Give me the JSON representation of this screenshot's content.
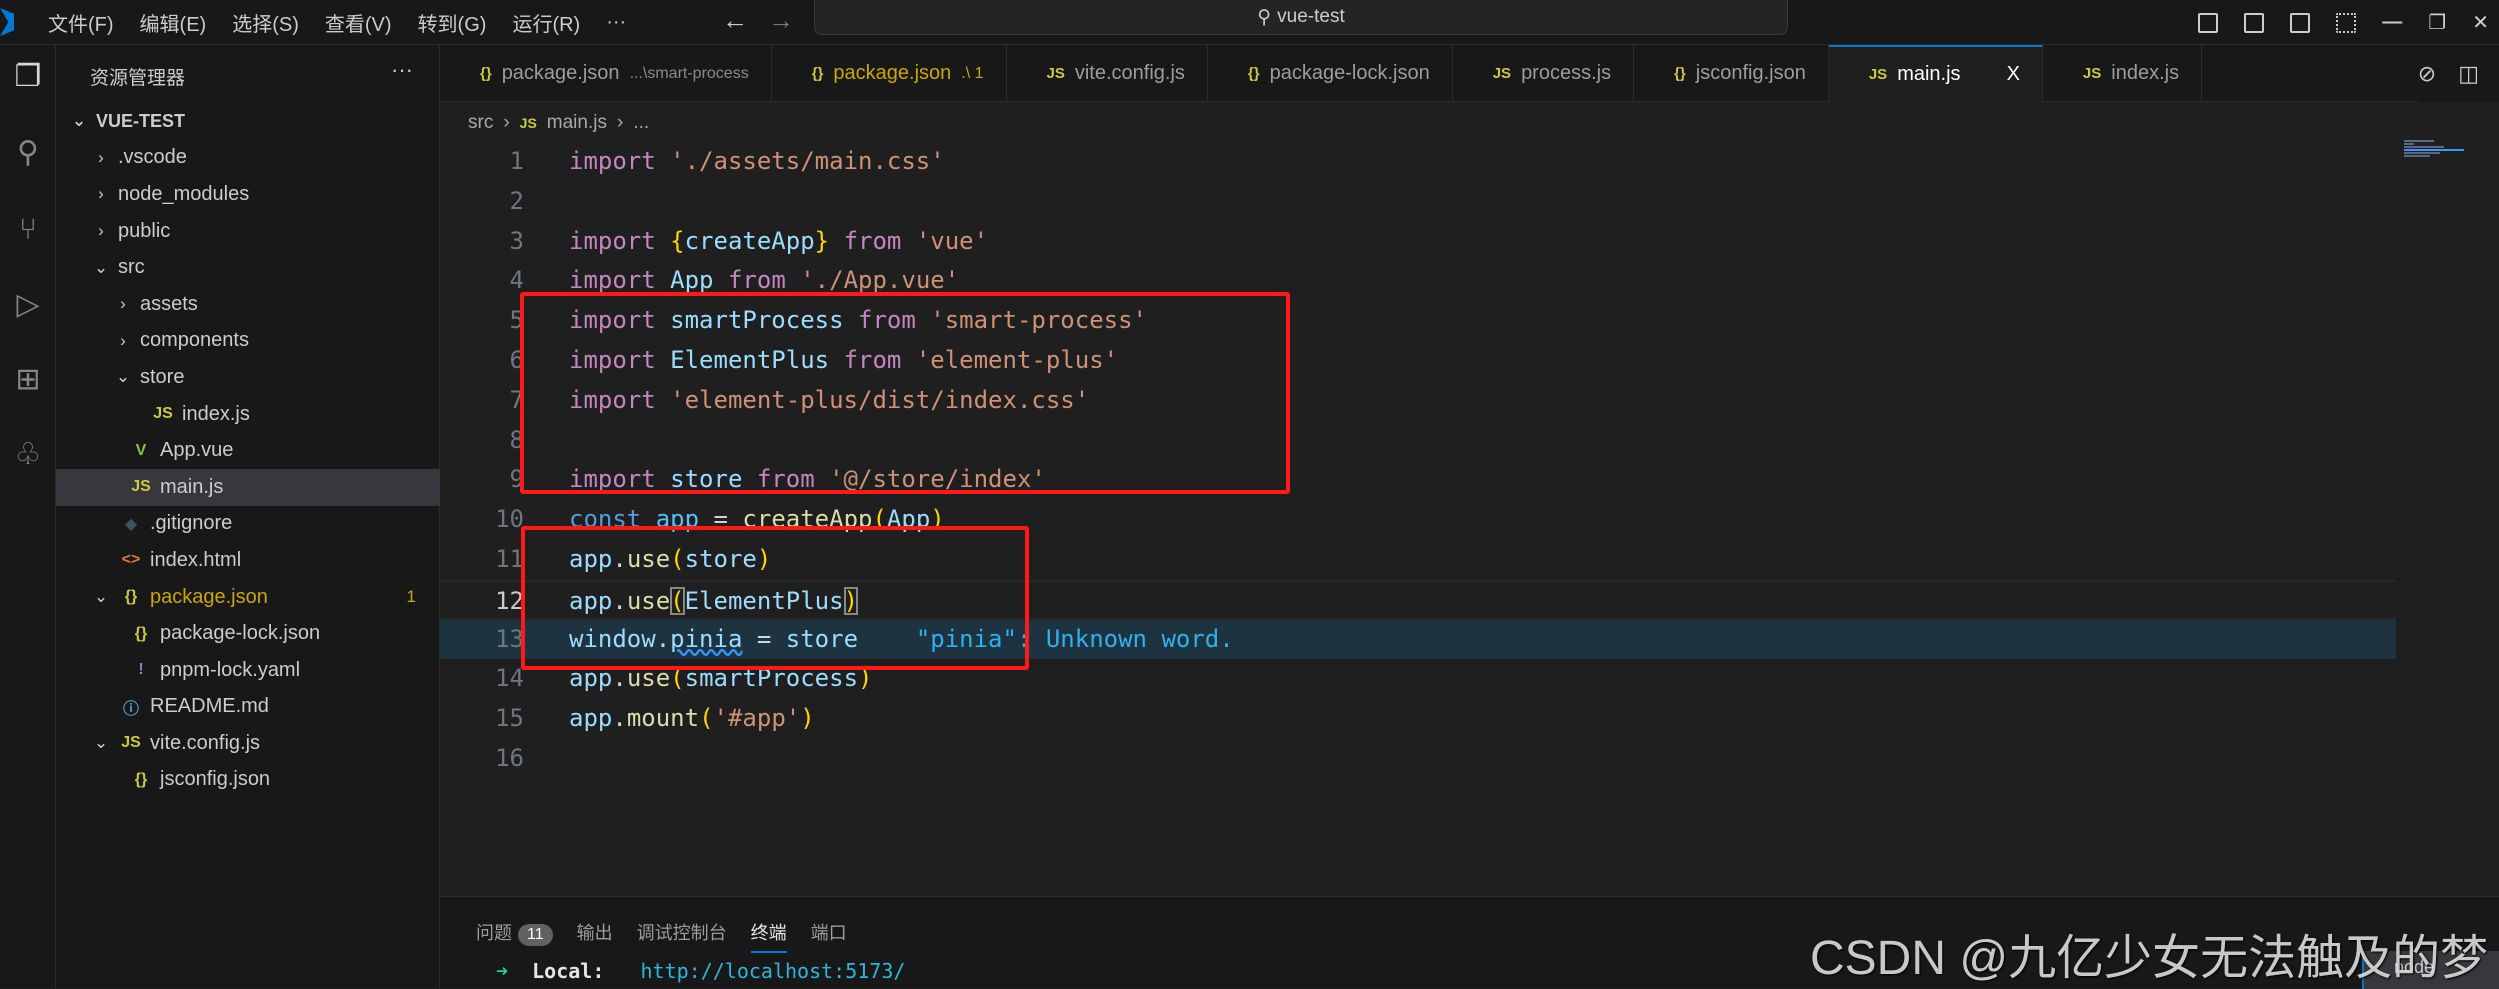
{
  "titlebar": {
    "menu": [
      "文件(F)",
      "编辑(E)",
      "选择(S)",
      "查看(V)",
      "转到(G)",
      "运行(R)",
      "···"
    ],
    "search": "vue-test",
    "back": "←",
    "forward": "→"
  },
  "sidebar": {
    "title": "资源管理器",
    "more": "···",
    "tree": [
      {
        "label": "VUE-TEST",
        "depth": 0,
        "chev": "⌄",
        "root": true
      },
      {
        "label": ".vscode",
        "depth": 1,
        "chev": "›"
      },
      {
        "label": "node_modules",
        "depth": 1,
        "chev": "›"
      },
      {
        "label": "public",
        "depth": 1,
        "chev": "›"
      },
      {
        "label": "src",
        "depth": 1,
        "chev": "⌄"
      },
      {
        "label": "assets",
        "depth": 2,
        "chev": "›"
      },
      {
        "label": "components",
        "depth": 2,
        "chev": "›"
      },
      {
        "label": "store",
        "depth": 2,
        "chev": "⌄"
      },
      {
        "label": "index.js",
        "depth": 3,
        "icon": "JS",
        "iconColor": "#cbcb41"
      },
      {
        "label": "App.vue",
        "depth": 2,
        "icon": "V",
        "iconColor": "#8dc149"
      },
      {
        "label": "main.js",
        "depth": 2,
        "icon": "JS",
        "iconColor": "#cbcb41",
        "selected": true
      },
      {
        "label": ".gitignore",
        "depth": 1,
        "icon": "◆",
        "iconColor": "#41535b"
      },
      {
        "label": "index.html",
        "depth": 1,
        "icon": "<>",
        "iconColor": "#e37933"
      },
      {
        "label": "package.json",
        "depth": 1,
        "chev": "⌄",
        "icon": "{}",
        "iconColor": "#cbcb41",
        "color": "#cca700",
        "badge": "1"
      },
      {
        "label": "package-lock.json",
        "depth": 2,
        "icon": "{}",
        "iconColor": "#cbcb41"
      },
      {
        "label": "pnpm-lock.yaml",
        "depth": 2,
        "icon": "!",
        "iconColor": "#a074c4"
      },
      {
        "label": "README.md",
        "depth": 1,
        "icon": "ⓘ",
        "iconColor": "#519aba"
      },
      {
        "label": "vite.config.js",
        "depth": 1,
        "chev": "⌄",
        "icon": "JS",
        "iconColor": "#cbcb41"
      },
      {
        "label": "jsconfig.json",
        "depth": 2,
        "icon": "{}",
        "iconColor": "#cbcb41"
      }
    ]
  },
  "tabs": [
    {
      "icon": "{}",
      "label": "package.json",
      "desc": "...\\smart-process"
    },
    {
      "icon": "{}",
      "label": "package.json",
      "desc": ".\\ 1",
      "modified": true
    },
    {
      "icon": "JS",
      "label": "vite.config.js"
    },
    {
      "icon": "{}",
      "label": "package-lock.json"
    },
    {
      "icon": "JS",
      "label": "process.js"
    },
    {
      "icon": "{}",
      "label": "jsconfig.json"
    },
    {
      "icon": "JS",
      "label": "main.js",
      "active": true,
      "close": "X"
    },
    {
      "icon": "JS",
      "label": "index.js"
    }
  ],
  "breadcrumb": {
    "folder": "src",
    "file": "main.js",
    "rest": "..."
  },
  "code": [
    [
      [
        "k",
        "import"
      ],
      [
        "p",
        " "
      ],
      [
        "s",
        "'./assets/main.css'"
      ]
    ],
    [],
    [
      [
        "k",
        "import"
      ],
      [
        "p",
        " "
      ],
      [
        "b",
        "{"
      ],
      [
        "v",
        "createApp"
      ],
      [
        "b",
        "}"
      ],
      [
        "p",
        " "
      ],
      [
        "k",
        "from"
      ],
      [
        "p",
        " "
      ],
      [
        "s",
        "'vue'"
      ]
    ],
    [
      [
        "k",
        "import"
      ],
      [
        "p",
        " "
      ],
      [
        "v",
        "App"
      ],
      [
        "p",
        " "
      ],
      [
        "k",
        "from"
      ],
      [
        "p",
        " "
      ],
      [
        "s",
        "'./App.vue'"
      ]
    ],
    [
      [
        "k",
        "import"
      ],
      [
        "p",
        " "
      ],
      [
        "v",
        "smartProcess"
      ],
      [
        "p",
        " "
      ],
      [
        "k",
        "from"
      ],
      [
        "p",
        " "
      ],
      [
        "s",
        "'smart-process'"
      ]
    ],
    [
      [
        "k",
        "import"
      ],
      [
        "p",
        " "
      ],
      [
        "v",
        "ElementPlus"
      ],
      [
        "p",
        " "
      ],
      [
        "k",
        "from"
      ],
      [
        "p",
        " "
      ],
      [
        "s",
        "'element-plus'"
      ]
    ],
    [
      [
        "k",
        "import"
      ],
      [
        "p",
        " "
      ],
      [
        "s",
        "'element-plus/dist/index.css'"
      ]
    ],
    [],
    [
      [
        "k",
        "import"
      ],
      [
        "p",
        " "
      ],
      [
        "v",
        "store"
      ],
      [
        "p",
        " "
      ],
      [
        "k",
        "from"
      ],
      [
        "p",
        " "
      ],
      [
        "s",
        "'@/store/index'"
      ]
    ],
    [
      [
        "c",
        "const"
      ],
      [
        "p",
        " "
      ],
      [
        "a",
        "app"
      ],
      [
        "p",
        " = "
      ],
      [
        "f",
        "createApp"
      ],
      [
        "b",
        "("
      ],
      [
        "v",
        "App"
      ],
      [
        "b",
        ")"
      ]
    ],
    [
      [
        "v",
        "app"
      ],
      [
        "p",
        "."
      ],
      [
        "f",
        "use"
      ],
      [
        "b",
        "("
      ],
      [
        "v",
        "store"
      ],
      [
        "b",
        ")"
      ]
    ],
    [
      [
        "v",
        "app"
      ],
      [
        "p",
        "."
      ],
      [
        "f",
        "use"
      ],
      [
        "bb",
        "("
      ],
      [
        "v",
        "ElementPlus"
      ],
      [
        "bb",
        ")"
      ]
    ],
    [
      [
        "v",
        "window"
      ],
      [
        "p",
        "."
      ],
      [
        "w",
        "pinia"
      ],
      [
        "p",
        " = "
      ],
      [
        "v",
        "store"
      ],
      [
        "p",
        "    "
      ],
      [
        "e",
        "\"pinia\": Unknown word."
      ]
    ],
    [
      [
        "v",
        "app"
      ],
      [
        "p",
        "."
      ],
      [
        "f",
        "use"
      ],
      [
        "b",
        "("
      ],
      [
        "v",
        "smartProcess"
      ],
      [
        "b",
        ")"
      ]
    ],
    [
      [
        "v",
        "app"
      ],
      [
        "p",
        "."
      ],
      [
        "f",
        "mount"
      ],
      [
        "b",
        "("
      ],
      [
        "s",
        "'#app'"
      ],
      [
        "b",
        ")"
      ]
    ],
    []
  ],
  "current_line": 12,
  "hint_line": 13,
  "panel": {
    "tabs": [
      {
        "label": "问题",
        "badge": "11"
      },
      {
        "label": "输出"
      },
      {
        "label": "调试控制台"
      },
      {
        "label": "终端",
        "active": true
      },
      {
        "label": "端口"
      }
    ],
    "terminal": {
      "arrow": "➜",
      "label": "Local:",
      "url": "http://localhost:5173/"
    },
    "shell": "node"
  },
  "watermark": "CSDN @九亿少女无法触及的梦",
  "colors": {
    "accent": "#0078d4",
    "annotation": "#ff1a1a"
  }
}
